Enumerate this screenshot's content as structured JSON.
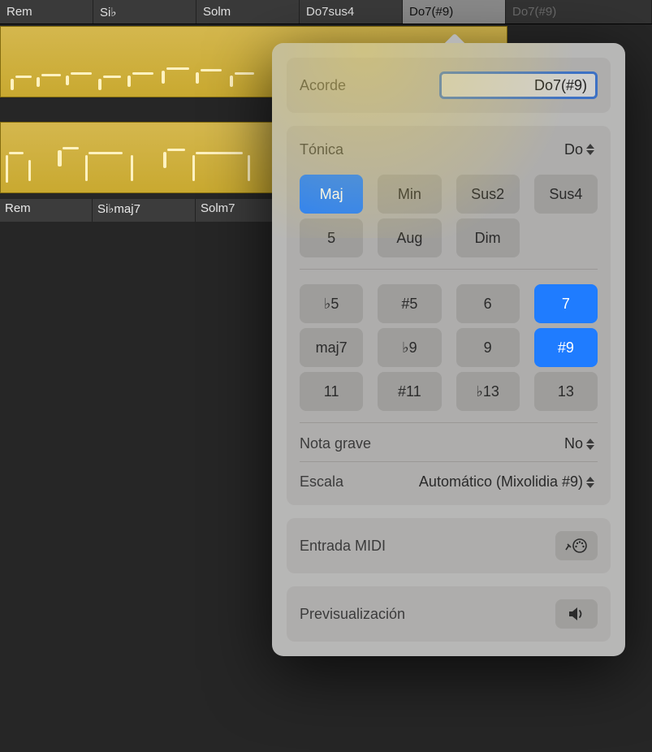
{
  "chord_bar": {
    "cells": [
      {
        "label": "Rem",
        "state": "normal"
      },
      {
        "label": "Si♭",
        "state": "normal"
      },
      {
        "label": "Solm",
        "state": "normal"
      },
      {
        "label": "Do7sus4",
        "state": "normal"
      },
      {
        "label": "Do7(#9)",
        "state": "selected"
      },
      {
        "label": "Do7(#9)",
        "state": "dim"
      }
    ]
  },
  "label_row": {
    "cells": [
      "Rem",
      "Si♭maj7",
      "Solm7"
    ]
  },
  "popover": {
    "chord": {
      "label": "Acorde",
      "value": "Do7(#9)"
    },
    "root": {
      "label": "Tónica",
      "value": "Do"
    },
    "quality_row1": [
      {
        "label": "Maj",
        "selected": true
      },
      {
        "label": "Min",
        "selected": false
      },
      {
        "label": "Sus2",
        "selected": false
      },
      {
        "label": "Sus4",
        "selected": false
      }
    ],
    "quality_row2": [
      {
        "label": "5",
        "selected": false
      },
      {
        "label": "Aug",
        "selected": false
      },
      {
        "label": "Dim",
        "selected": false
      }
    ],
    "extensions_row1": [
      {
        "label": "♭5",
        "selected": false
      },
      {
        "label": "#5",
        "selected": false
      },
      {
        "label": "6",
        "selected": false
      },
      {
        "label": "7",
        "selected": true
      }
    ],
    "extensions_row2": [
      {
        "label": "maj7",
        "selected": false
      },
      {
        "label": "♭9",
        "selected": false
      },
      {
        "label": "9",
        "selected": false
      },
      {
        "label": "#9",
        "selected": true
      }
    ],
    "extensions_row3": [
      {
        "label": "11",
        "selected": false
      },
      {
        "label": "#11",
        "selected": false
      },
      {
        "label": "♭13",
        "selected": false
      },
      {
        "label": "13",
        "selected": false
      }
    ],
    "bass_note": {
      "label": "Nota grave",
      "value": "No"
    },
    "scale": {
      "label": "Escala",
      "value": "Automático (Mixolidia #9)"
    },
    "midi_in": {
      "label": "Entrada MIDI",
      "icon": "midi-in-icon"
    },
    "preview": {
      "label": "Previsualización",
      "icon": "speaker-icon"
    }
  }
}
